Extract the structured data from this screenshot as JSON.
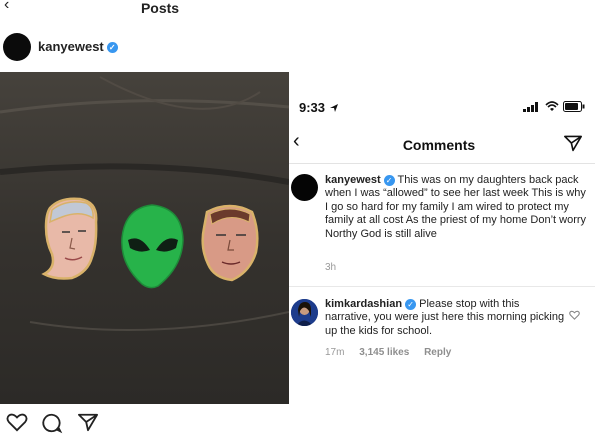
{
  "left_post": {
    "header_title": "Posts",
    "username": "kanyewest",
    "photo_alt_subject": "pins on a backpack"
  },
  "right_comments": {
    "status_time": "9:33",
    "nav_title": "Comments",
    "comment1": {
      "username": "kanyewest",
      "text": "This was on my daughters back pack when I was “allowed” to see her last week This is why I go so hard for my family  I am wired to protect my family at all cost  As the priest of my home  Don’t worry Northy  God is still alive",
      "time": "3h"
    },
    "comment2": {
      "username": "kimkardashian",
      "text": "Please stop with this narrative, you were just here this morning picking up the kids for school.",
      "time": "17m",
      "likes": "3,145 likes",
      "reply": "Reply"
    }
  },
  "colors": {
    "verified_blue": "#3897f0",
    "alien_green": "#27b34a",
    "pin_gold": "#d9b26a"
  },
  "icons": [
    "heart-icon",
    "comment-icon",
    "send-icon",
    "back-arrow-icon",
    "location-arrow-icon",
    "signal-icon",
    "wifi-icon",
    "battery-icon",
    "verified-badge-icon"
  ]
}
